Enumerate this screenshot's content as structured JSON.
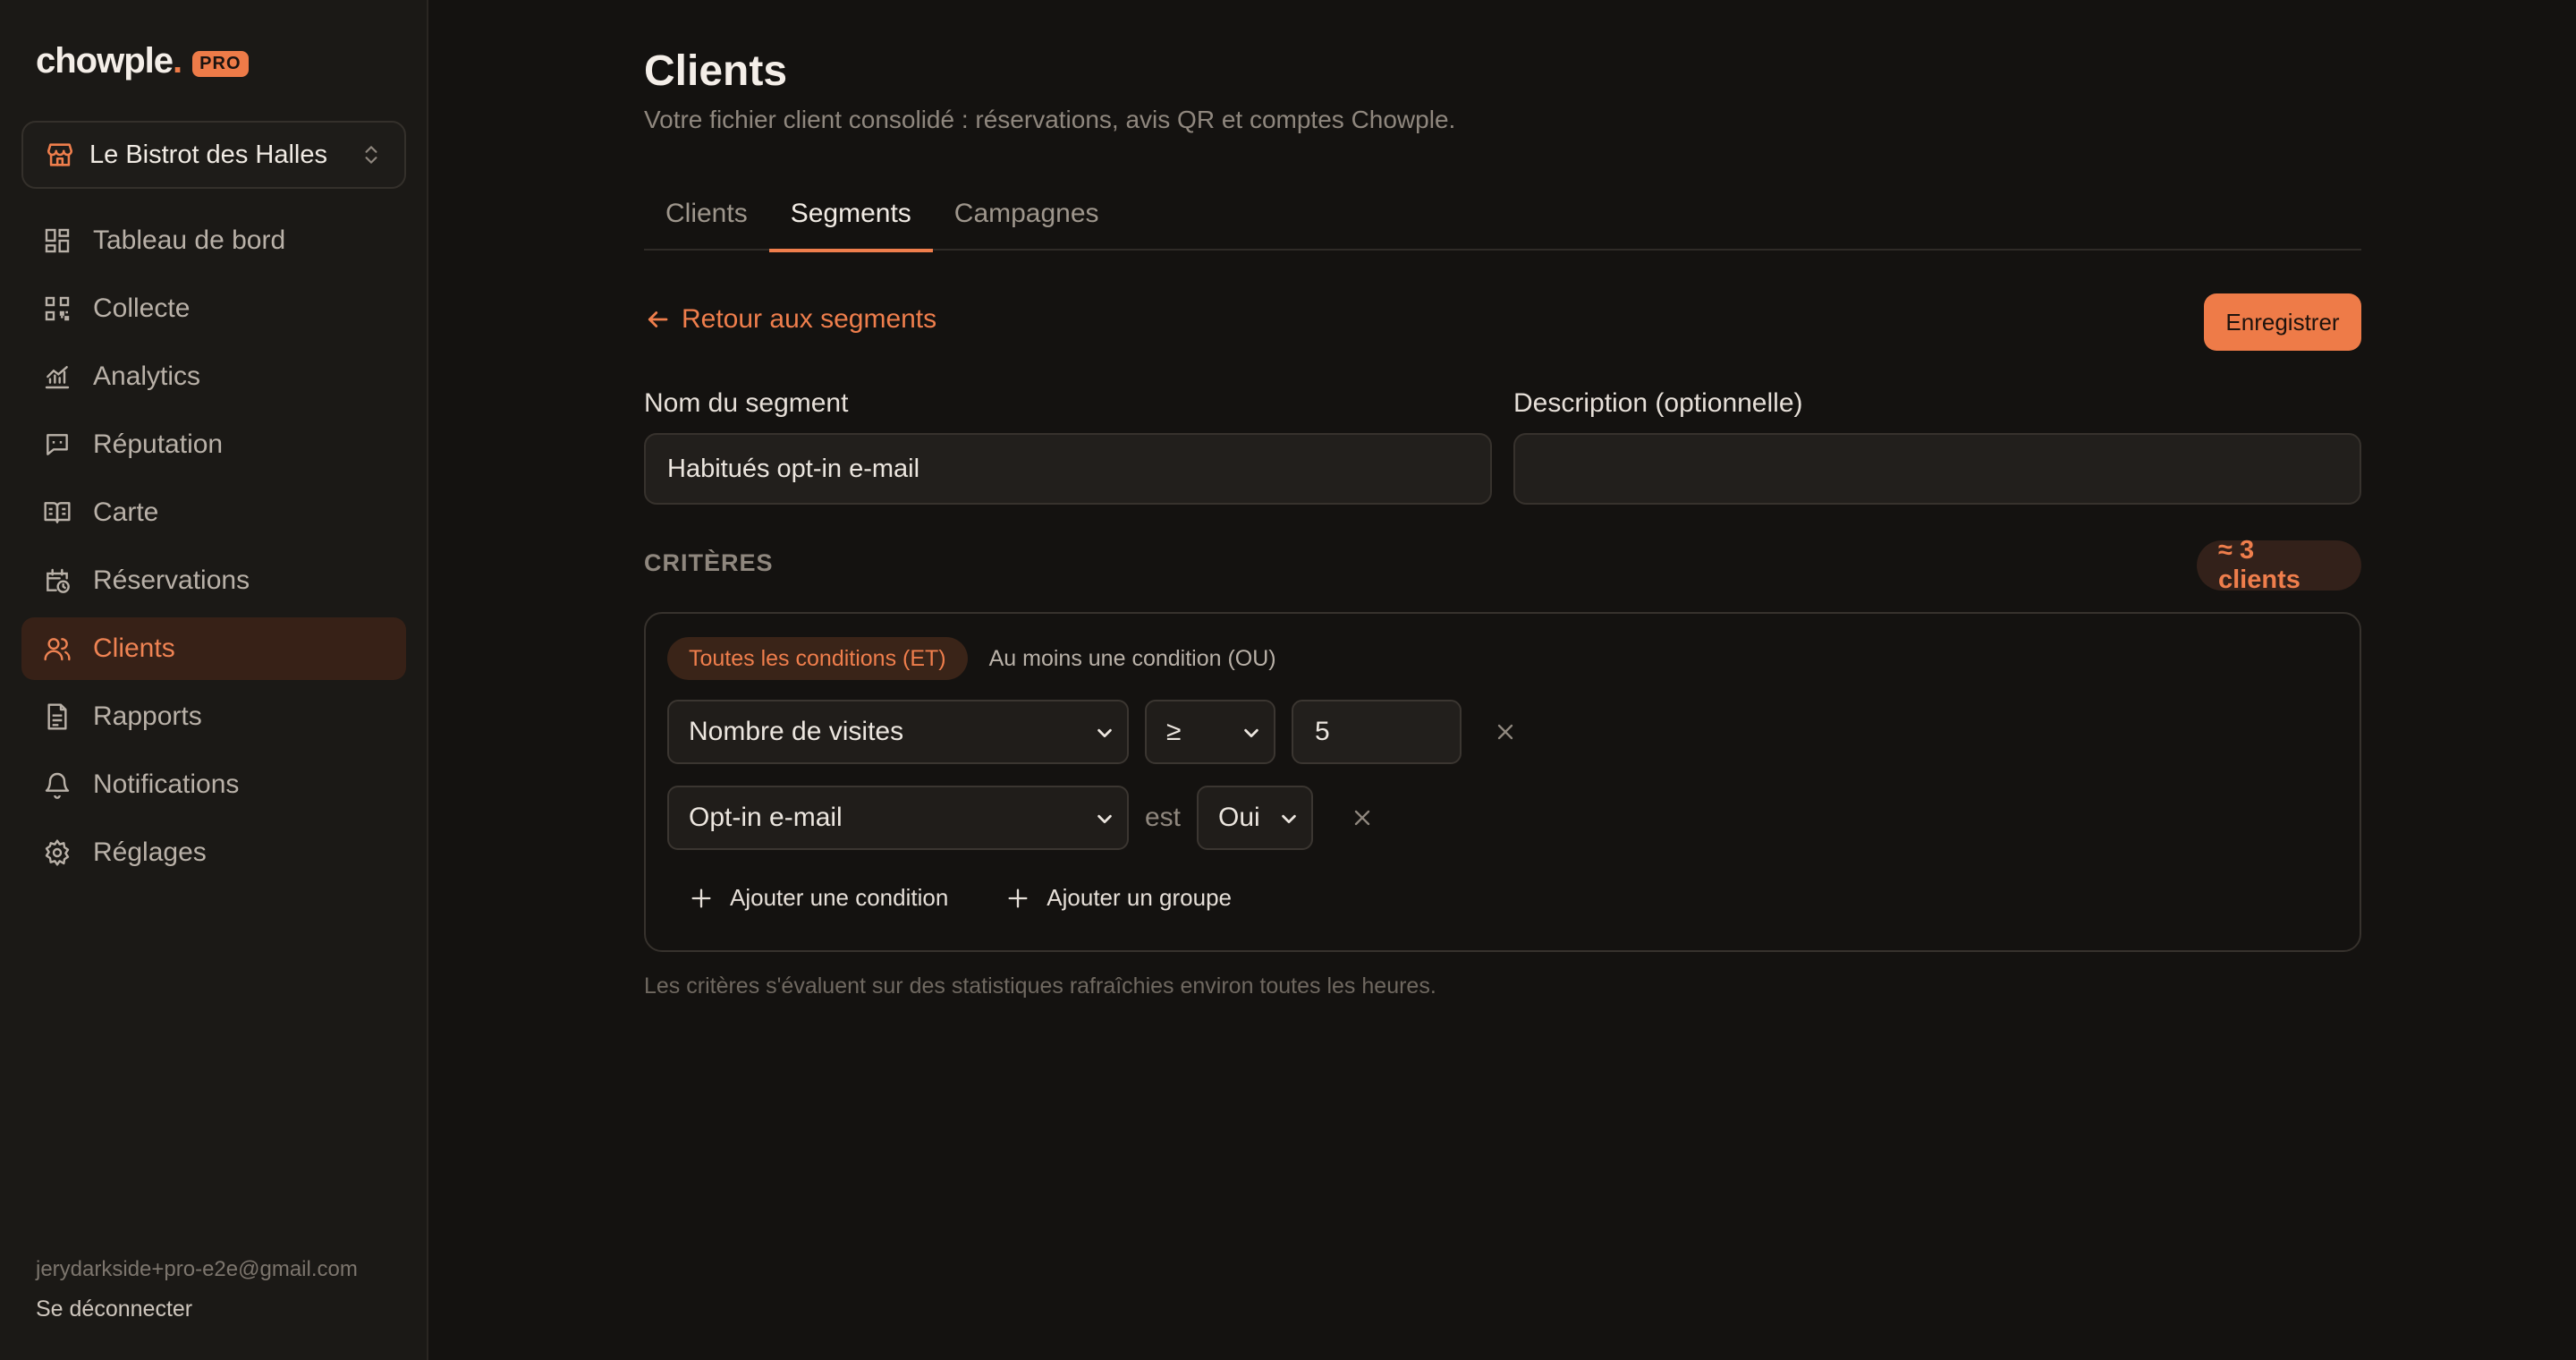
{
  "app": {
    "logo": "chowple",
    "logo_dot": ".",
    "badge": "PRO",
    "accent_color": "#ee7b48"
  },
  "venue": {
    "name": "Le Bistrot des Halles"
  },
  "sidebar": {
    "items": [
      {
        "label": "Tableau de bord",
        "icon": "dashboard-icon"
      },
      {
        "label": "Collecte",
        "icon": "qr-code-icon"
      },
      {
        "label": "Analytics",
        "icon": "chart-icon"
      },
      {
        "label": "Réputation",
        "icon": "message-square-icon"
      },
      {
        "label": "Carte",
        "icon": "book-open-icon"
      },
      {
        "label": "Réservations",
        "icon": "calendar-clock-icon"
      },
      {
        "label": "Clients",
        "icon": "users-icon",
        "active": true
      },
      {
        "label": "Rapports",
        "icon": "file-text-icon"
      },
      {
        "label": "Notifications",
        "icon": "bell-icon"
      },
      {
        "label": "Réglages",
        "icon": "settings-icon"
      }
    ],
    "email": "jerydarkside+pro-e2e@gmail.com",
    "logout": "Se déconnecter"
  },
  "page": {
    "title": "Clients",
    "subtitle": "Votre fichier client consolidé : réservations, avis QR et comptes Chowple.",
    "tabs": [
      {
        "label": "Clients",
        "active": false
      },
      {
        "label": "Segments",
        "active": true
      },
      {
        "label": "Campagnes",
        "active": false
      }
    ],
    "back_label": "Retour aux segments",
    "save_label": "Enregistrer"
  },
  "form": {
    "name_label": "Nom du segment",
    "name_value": "Habitués opt-in e-mail",
    "desc_label": "Description (optionnelle)",
    "desc_value": ""
  },
  "criteria": {
    "title": "CRITÈRES",
    "count": "≈ 3 clients",
    "logic_all": "Toutes les conditions (ET)",
    "logic_any": "Au moins une condition (OU)",
    "logic_selected": "all",
    "conditions": [
      {
        "field": "Nombre de visites",
        "operator": "≥",
        "value": "5"
      },
      {
        "field": "Opt-in e-mail",
        "connector": "est",
        "value": "Oui"
      }
    ],
    "add_condition": "Ajouter une condition",
    "add_group": "Ajouter un groupe",
    "footnote": "Les critères s'évaluent sur des statistiques rafraîchies environ toutes les heures."
  }
}
